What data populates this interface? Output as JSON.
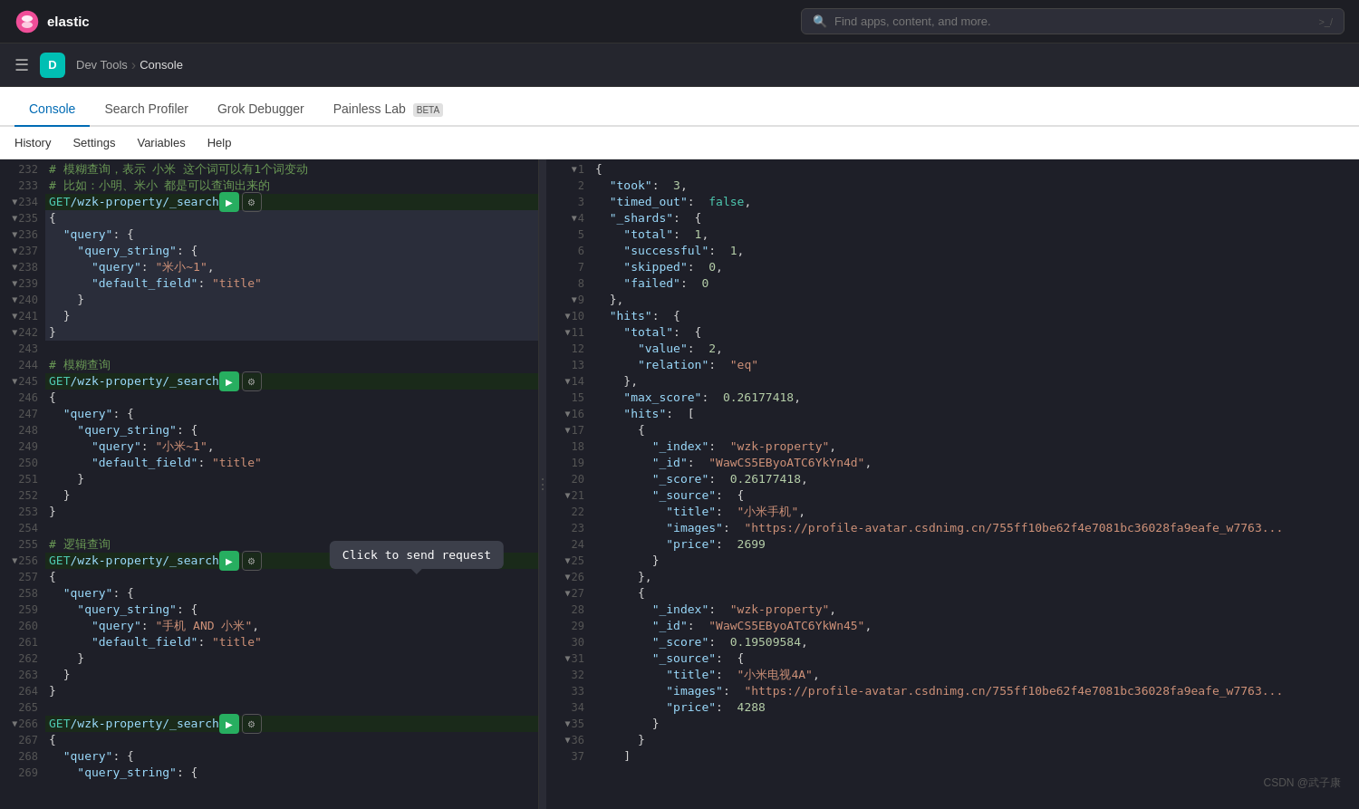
{
  "topNav": {
    "logoText": "elastic",
    "searchPlaceholder": "Find apps, content, and more.",
    "keyboardShortcut": ">_/"
  },
  "appHeader": {
    "avatarLetter": "D",
    "breadcrumb": [
      "Dev Tools",
      "Console"
    ]
  },
  "tabs": [
    {
      "label": "Console",
      "active": true
    },
    {
      "label": "Search Profiler",
      "active": false
    },
    {
      "label": "Grok Debugger",
      "active": false
    },
    {
      "label": "Painless Lab",
      "active": false,
      "beta": "BETA"
    }
  ],
  "subNav": [
    "History",
    "Settings",
    "Variables",
    "Help"
  ],
  "tooltip": {
    "text": "Click to send request"
  },
  "watermark": "CSDN @武子康",
  "editor": {
    "lines": [
      {
        "num": 232,
        "content": "# 模糊查询，表示 小米 这个词可以有1个词变动",
        "type": "comment"
      },
      {
        "num": 233,
        "content": "# 比如：小明、米小 都是可以查询出来的",
        "type": "comment"
      },
      {
        "num": 234,
        "content": "GET /wzk-property/_search",
        "type": "get"
      },
      {
        "num": 235,
        "content": "{",
        "type": "punct",
        "highlighted": true
      },
      {
        "num": 236,
        "content": "  \"query\": {",
        "type": "code",
        "highlighted": true
      },
      {
        "num": 237,
        "content": "    \"query_string\": {",
        "type": "code",
        "highlighted": true
      },
      {
        "num": 238,
        "content": "      \"query\": \"米小~1\",",
        "type": "code",
        "highlighted": true
      },
      {
        "num": 239,
        "content": "      \"default_field\": \"title\"",
        "type": "code",
        "highlighted": true
      },
      {
        "num": 240,
        "content": "    }",
        "type": "code",
        "highlighted": true
      },
      {
        "num": 241,
        "content": "  }",
        "type": "code",
        "highlighted": true
      },
      {
        "num": 242,
        "content": "}",
        "type": "code",
        "highlighted": true
      },
      {
        "num": 243,
        "content": "",
        "type": "empty"
      },
      {
        "num": 244,
        "content": "# 模糊查询",
        "type": "comment"
      },
      {
        "num": 245,
        "content": "GET /wzk-property/_search",
        "type": "get"
      },
      {
        "num": 246,
        "content": "{",
        "type": "punct"
      },
      {
        "num": 247,
        "content": "  \"query\": {",
        "type": "code"
      },
      {
        "num": 248,
        "content": "    \"query_string\": {",
        "type": "code"
      },
      {
        "num": 249,
        "content": "      \"query\": \"小米~1\",",
        "type": "code"
      },
      {
        "num": 250,
        "content": "      \"default_field\": \"title\"",
        "type": "code"
      },
      {
        "num": 251,
        "content": "    }",
        "type": "code"
      },
      {
        "num": 252,
        "content": "  }",
        "type": "code"
      },
      {
        "num": 253,
        "content": "}",
        "type": "code"
      },
      {
        "num": 254,
        "content": "",
        "type": "empty"
      },
      {
        "num": 255,
        "content": "# 逻辑查询",
        "type": "comment"
      },
      {
        "num": 256,
        "content": "GET /wzk-property/_search",
        "type": "get"
      },
      {
        "num": 257,
        "content": "{",
        "type": "punct"
      },
      {
        "num": 258,
        "content": "  \"query\": {",
        "type": "code"
      },
      {
        "num": 259,
        "content": "    \"query_string\": {",
        "type": "code"
      },
      {
        "num": 260,
        "content": "      \"query\": \"手机 AND 小米\",",
        "type": "code"
      },
      {
        "num": 261,
        "content": "      \"default_field\": \"title\"",
        "type": "code"
      },
      {
        "num": 262,
        "content": "    }",
        "type": "code"
      },
      {
        "num": 263,
        "content": "  }",
        "type": "code"
      },
      {
        "num": 264,
        "content": "}",
        "type": "code"
      },
      {
        "num": 265,
        "content": "",
        "type": "empty"
      },
      {
        "num": 266,
        "content": "GET /wzk-property/_search",
        "type": "get"
      },
      {
        "num": 267,
        "content": "{",
        "type": "punct"
      },
      {
        "num": 268,
        "content": "  \"query\": {",
        "type": "code"
      },
      {
        "num": 269,
        "content": "    \"query_string\": {",
        "type": "code"
      }
    ]
  },
  "result": {
    "lines": [
      {
        "num": 1,
        "html": "{ ",
        "arrow": true
      },
      {
        "num": 2,
        "html": "  \"took\":  3,"
      },
      {
        "num": 3,
        "html": "  \"timed_out\":  false,"
      },
      {
        "num": 4,
        "html": "  \"_shards\":  {",
        "arrow": true
      },
      {
        "num": 5,
        "html": "    \"total\":  1,"
      },
      {
        "num": 6,
        "html": "    \"successful\":  1,"
      },
      {
        "num": 7,
        "html": "    \"skipped\":  0,"
      },
      {
        "num": 8,
        "html": "    \"failed\":  0"
      },
      {
        "num": 9,
        "html": "  },",
        "arrow": true
      },
      {
        "num": 10,
        "html": "  \"hits\":  {",
        "arrow": true
      },
      {
        "num": 11,
        "html": "    \"total\":  {",
        "arrow": true
      },
      {
        "num": 12,
        "html": "      \"value\":  2,"
      },
      {
        "num": 13,
        "html": "      \"relation\":  \"eq\""
      },
      {
        "num": 14,
        "html": "    },",
        "arrow": true
      },
      {
        "num": 15,
        "html": "    \"max_score\":  0.26177418,"
      },
      {
        "num": 16,
        "html": "    \"hits\":  [",
        "arrow": true
      },
      {
        "num": 17,
        "html": "      {",
        "arrow": true
      },
      {
        "num": 18,
        "html": "        \"_index\":  \"wzk-property\","
      },
      {
        "num": 19,
        "html": "        \"_id\":  \"WawCS5EByoATC6YkYn4d\","
      },
      {
        "num": 20,
        "html": "        \"_score\":  0.26177418,"
      },
      {
        "num": 21,
        "html": "        \"_source\":  {",
        "arrow": true
      },
      {
        "num": 22,
        "html": "          \"title\":  \"小米手机\","
      },
      {
        "num": 23,
        "html": "          \"images\":  \"https://profile-avatar.csdnimg.cn/755ff10be62f4e7081bc36028fa9eafe_w7763..."
      },
      {
        "num": 24,
        "html": "          \"price\":  2699"
      },
      {
        "num": 25,
        "html": "        }",
        "arrow": true
      },
      {
        "num": 26,
        "html": "      },",
        "arrow": true
      },
      {
        "num": 27,
        "html": "      {",
        "arrow": true
      },
      {
        "num": 28,
        "html": "        \"_index\":  \"wzk-property\","
      },
      {
        "num": 29,
        "html": "        \"_id\":  \"WawCS5EByoATC6YkWn45\","
      },
      {
        "num": 30,
        "html": "        \"_score\":  0.19509584,"
      },
      {
        "num": 31,
        "html": "        \"_source\":  {",
        "arrow": true
      },
      {
        "num": 32,
        "html": "          \"title\":  \"小米电视4A\","
      },
      {
        "num": 33,
        "html": "          \"images\":  \"https://profile-avatar.csdnimg.cn/755ff10be62f4e7081bc36028fa9eafe_w7763..."
      },
      {
        "num": 34,
        "html": "          \"price\":  4288"
      },
      {
        "num": 35,
        "html": "        }",
        "arrow": true
      },
      {
        "num": 36,
        "html": "      }",
        "arrow": true
      },
      {
        "num": 37,
        "html": "    ]"
      }
    ]
  }
}
